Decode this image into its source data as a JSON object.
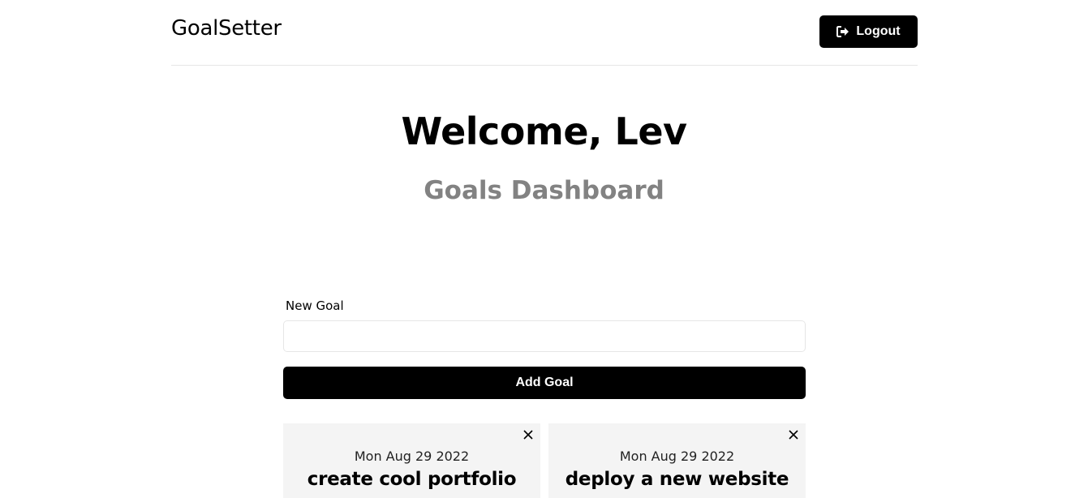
{
  "header": {
    "brand": "GoalSetter",
    "logout_label": "Logout",
    "logout_icon": "sign-out-icon"
  },
  "heading": {
    "welcome": "Welcome, Lev",
    "subtitle": "Goals Dashboard"
  },
  "form": {
    "label": "New Goal",
    "input_value": "",
    "submit_label": "Add Goal"
  },
  "goals": [
    {
      "date": "Mon Aug 29 2022",
      "text": "create cool portfolio",
      "delete_icon": "close-icon"
    },
    {
      "date": "Mon Aug 29 2022",
      "text": "deploy a new website",
      "delete_icon": "close-icon"
    }
  ],
  "colors": {
    "primary": "#000000",
    "subtitle": "#828282",
    "card_background": "#f4f4f4",
    "divider": "#e6e6e6"
  }
}
